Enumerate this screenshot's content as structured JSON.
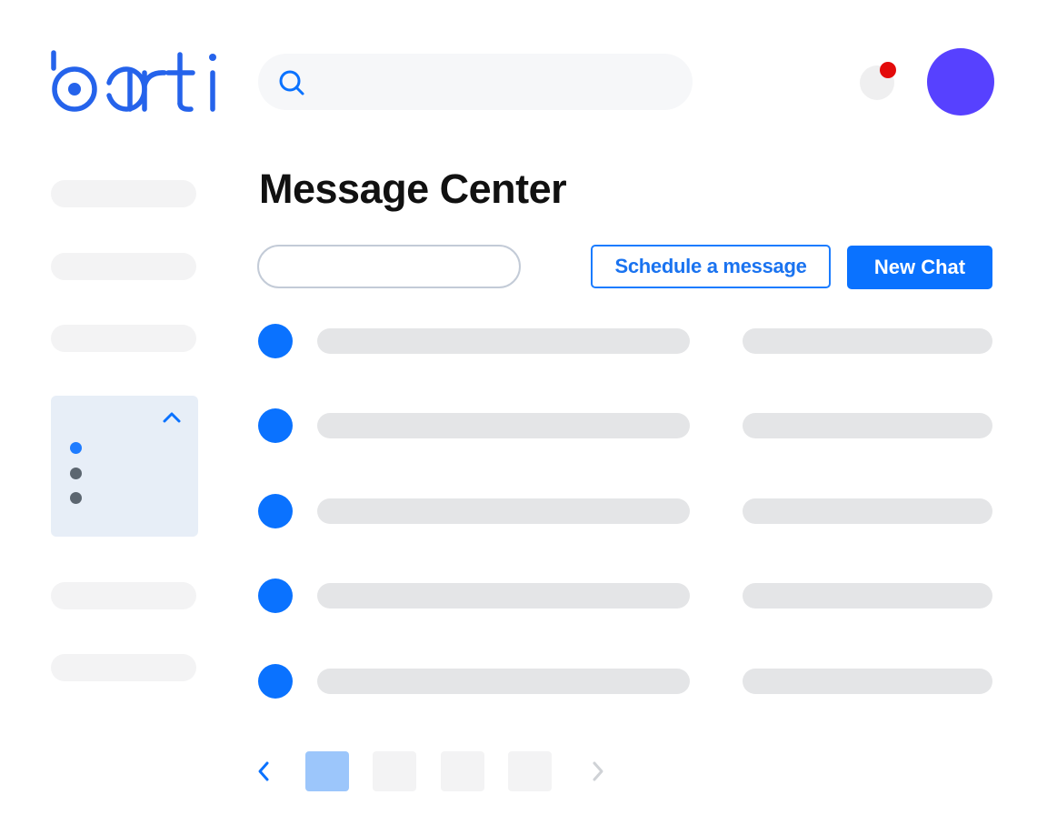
{
  "app": {
    "logo_text": "barti",
    "brand_color": "#2563eb"
  },
  "header": {
    "search": {
      "placeholder": "",
      "value": "",
      "icon": "search-icon"
    },
    "notifications": {
      "icon": "bell-icon",
      "has_unread": true,
      "dot_color": "#e30b0b"
    },
    "avatar": {
      "color": "#5741ff"
    }
  },
  "sidebar": {
    "expanded_panel": {
      "expanded": true,
      "icon": "chevron-up-icon",
      "dot_colors": [
        "#1e7cff",
        "#5c6670",
        "#5c6670"
      ]
    }
  },
  "main": {
    "title": "Message Center",
    "filter": {
      "placeholder": "",
      "value": ""
    },
    "buttons": {
      "schedule": "Schedule a message",
      "new_chat": "New Chat"
    },
    "list_row_count": 5
  },
  "pagination": {
    "pages": 4,
    "current": 1,
    "prev_icon": "chevron-left-icon",
    "next_icon": "chevron-right-icon",
    "accent": "#0a72ff",
    "active_page_color": "#9cc6fb"
  }
}
